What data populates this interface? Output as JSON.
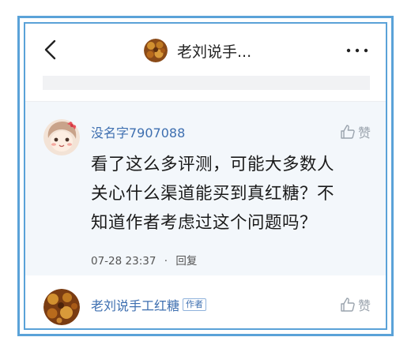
{
  "header": {
    "title": "老刘说手...",
    "back_icon": "chevron-left-icon",
    "more_icon": "more-dots-icon"
  },
  "comments": [
    {
      "author": "没名字7907088",
      "text_lines": [
        "看了这么多评测，可能大多数人",
        "关心什么渠道能买到真红糖？不",
        "知道作者考虑过这个问题吗？"
      ],
      "time": "07-28 23:37",
      "separator": "·",
      "reply_label": "回复",
      "like_label": "赞"
    },
    {
      "author": "老刘说手工红糖",
      "badge": "作者",
      "like_label": "赞"
    }
  ],
  "colors": {
    "frame": "#5aa2d8",
    "author_link": "#3e6fb0",
    "comment_bg": "#f3f7fb"
  }
}
